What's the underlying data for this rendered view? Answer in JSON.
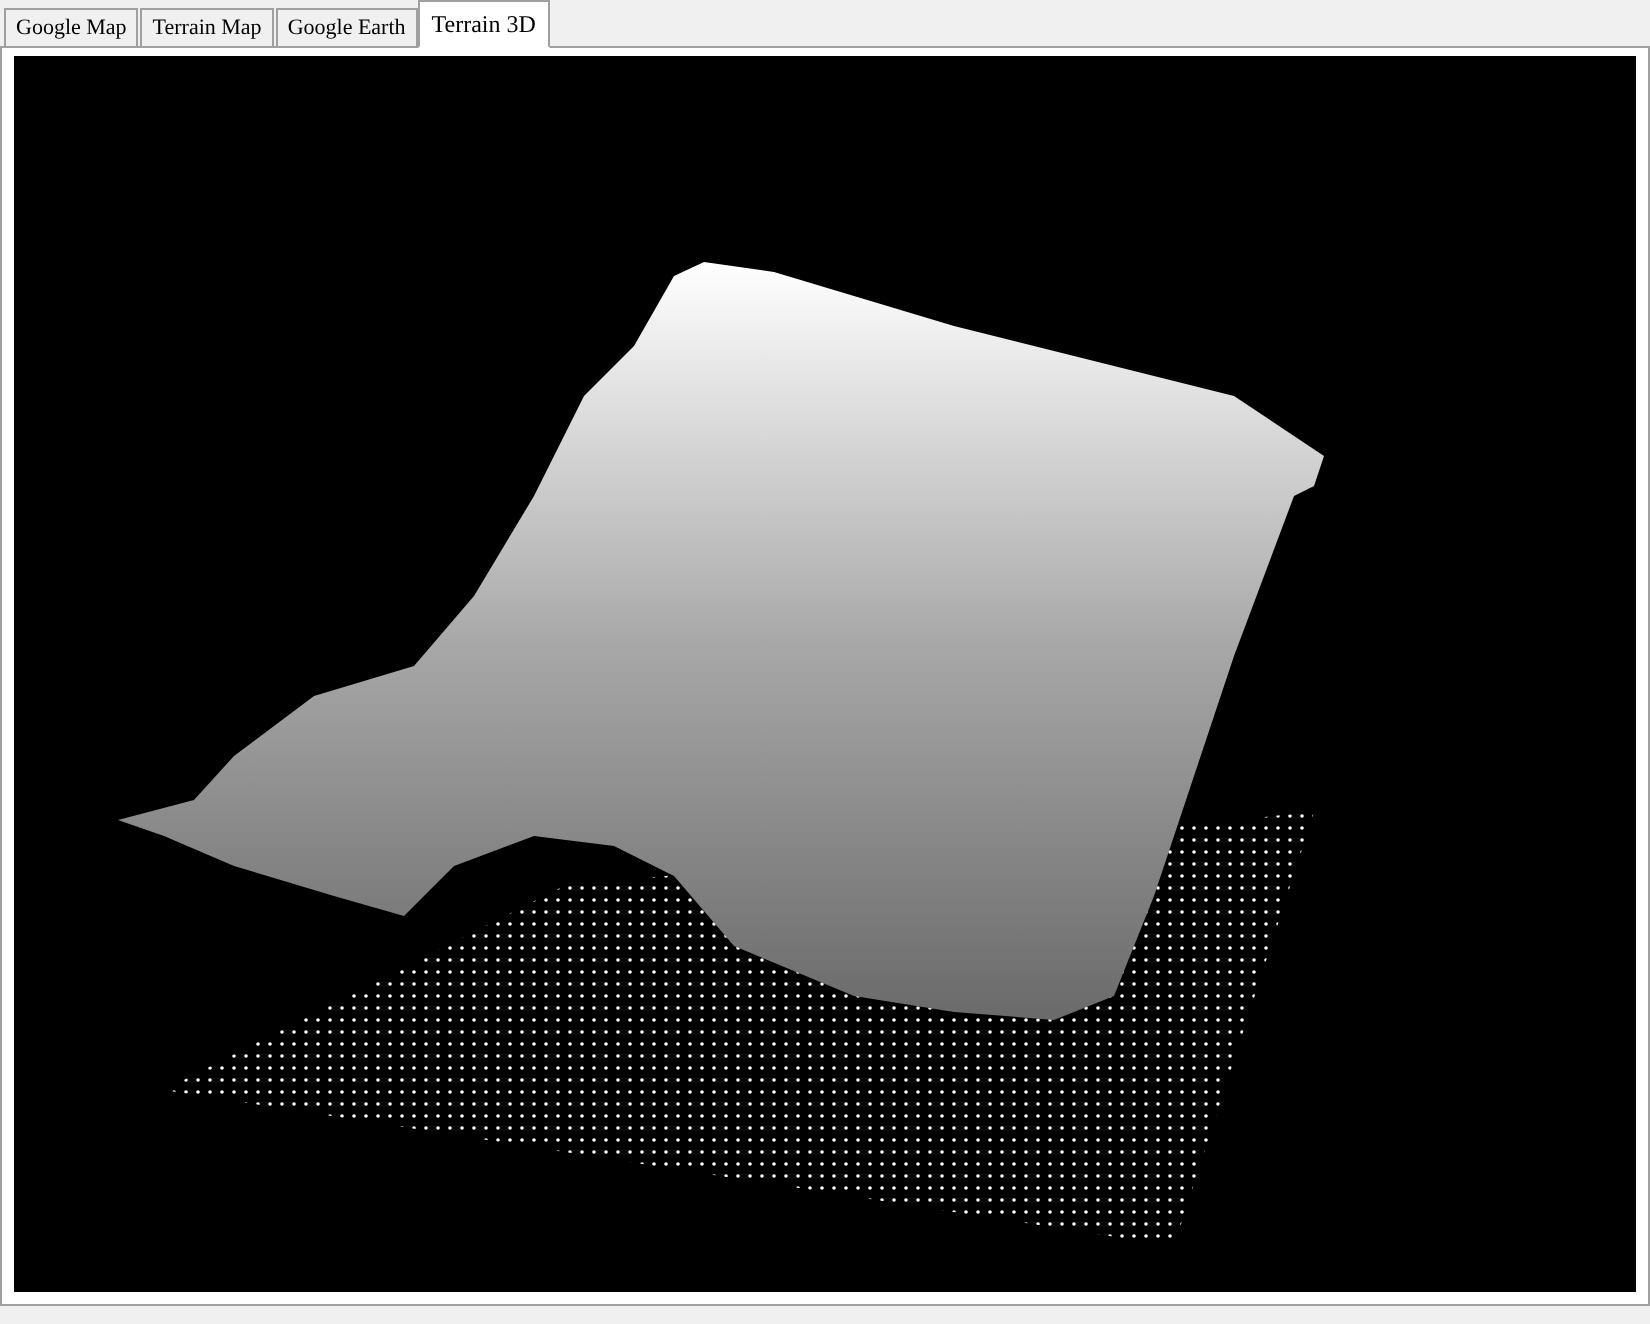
{
  "tabs": [
    {
      "label": "Google Map",
      "selected": false
    },
    {
      "label": "Terrain Map",
      "selected": false
    },
    {
      "label": "Google Earth",
      "selected": false
    },
    {
      "label": "Terrain 3D",
      "selected": true
    }
  ]
}
